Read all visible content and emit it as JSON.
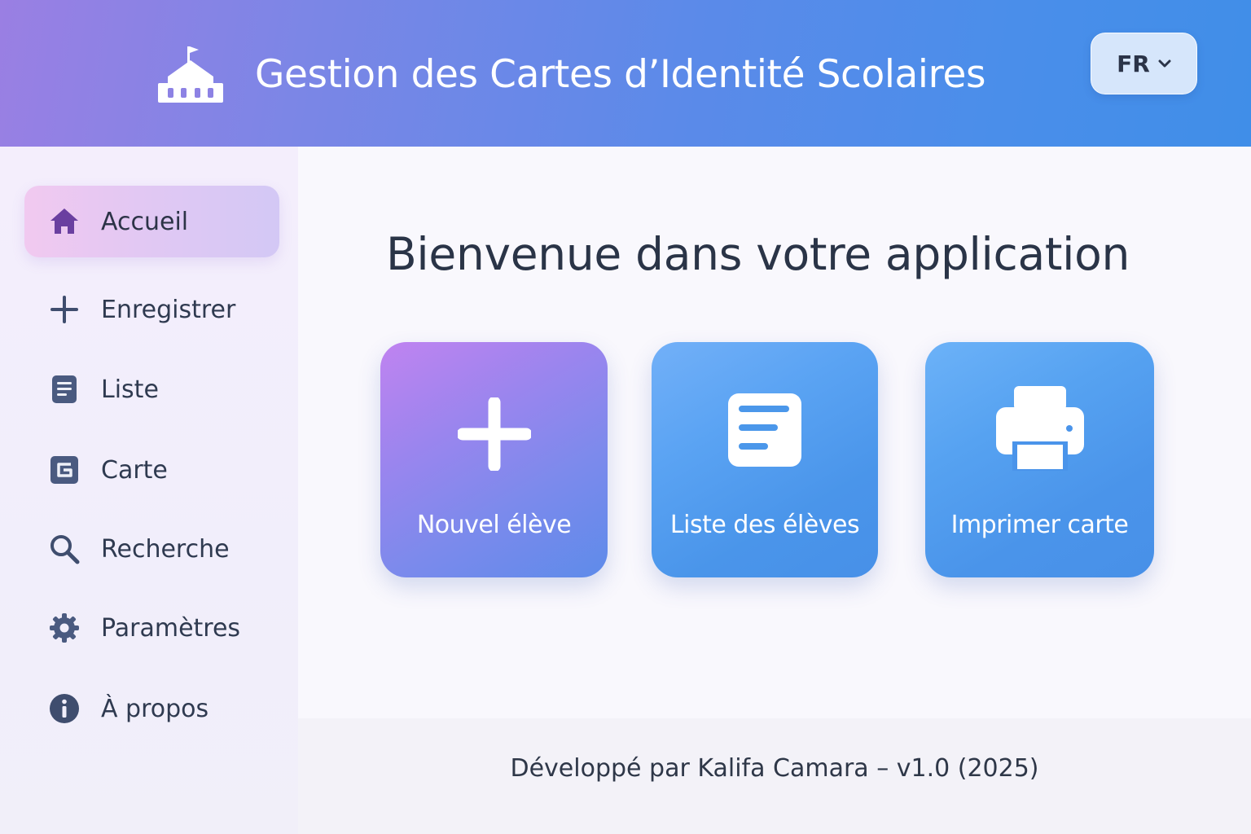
{
  "header": {
    "title": "Gestion des Cartes d’Identité Scolaires",
    "logo_icon": "school-icon",
    "language": {
      "label": "FR",
      "icon": "chevron-down-icon"
    }
  },
  "sidebar": {
    "items": [
      {
        "label": "Accueil",
        "icon": "home-icon",
        "active": true
      },
      {
        "label": "Enregistrer",
        "icon": "plus-icon",
        "active": false
      },
      {
        "label": "Liste",
        "icon": "document-icon",
        "active": false
      },
      {
        "label": "Carte",
        "icon": "card-icon",
        "active": false
      },
      {
        "label": "Recherche",
        "icon": "search-icon",
        "active": false
      },
      {
        "label": "Paramètres",
        "icon": "gear-icon",
        "active": false
      },
      {
        "label": "À propos",
        "icon": "info-icon",
        "active": false
      }
    ]
  },
  "main": {
    "title": "Bienvenue dans votre application",
    "tiles": [
      {
        "label": "Nouvel élève",
        "icon": "plus-icon"
      },
      {
        "label": "Liste des élèves",
        "icon": "list-icon"
      },
      {
        "label": "Imprimer carte",
        "icon": "printer-icon"
      }
    ]
  },
  "footer": {
    "text": "Développé par Kalifa Camara – v1.0 (2025)"
  },
  "colors": {
    "header_gradient_start": "#9a7fe3",
    "header_gradient_end": "#408ee8",
    "sidebar_active": "#e2c8f3",
    "icon_active": "#6a3fa0",
    "icon_default": "#3f4d6e",
    "tile_new_student": "#9a85ee",
    "tile_list": "#4a95ea",
    "tile_print": "#4a94ea"
  }
}
